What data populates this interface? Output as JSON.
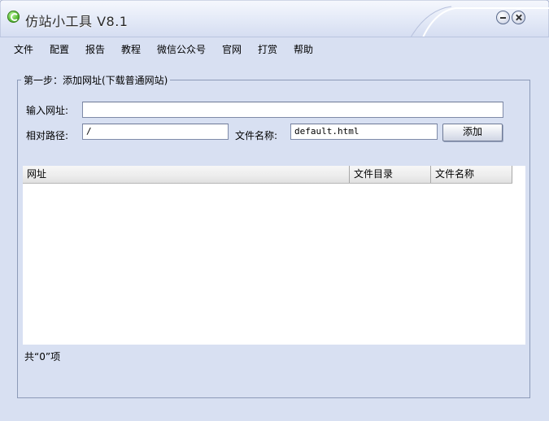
{
  "window": {
    "title": "仿站小工具 V8.1",
    "minimize_icon": "minimize-icon",
    "close_icon": "close-icon"
  },
  "menu": [
    "文件",
    "配置",
    "报告",
    "教程",
    "微信公众号",
    "官网",
    "打赏",
    "帮助"
  ],
  "step1": {
    "title": "第一步：添加网址(下载普通网站)",
    "url_label": "输入网址:",
    "url_value": "",
    "path_label": "相对路径:",
    "path_value": "/",
    "filename_label": "文件名称:",
    "filename_value": "default.html",
    "add_button": "添加"
  },
  "table": {
    "columns": [
      "网址",
      "文件目录",
      "文件名称"
    ],
    "rows": []
  },
  "status": "共“0”项",
  "colors": {
    "background": "#d8e0f2",
    "border": "#8c9ab8"
  }
}
